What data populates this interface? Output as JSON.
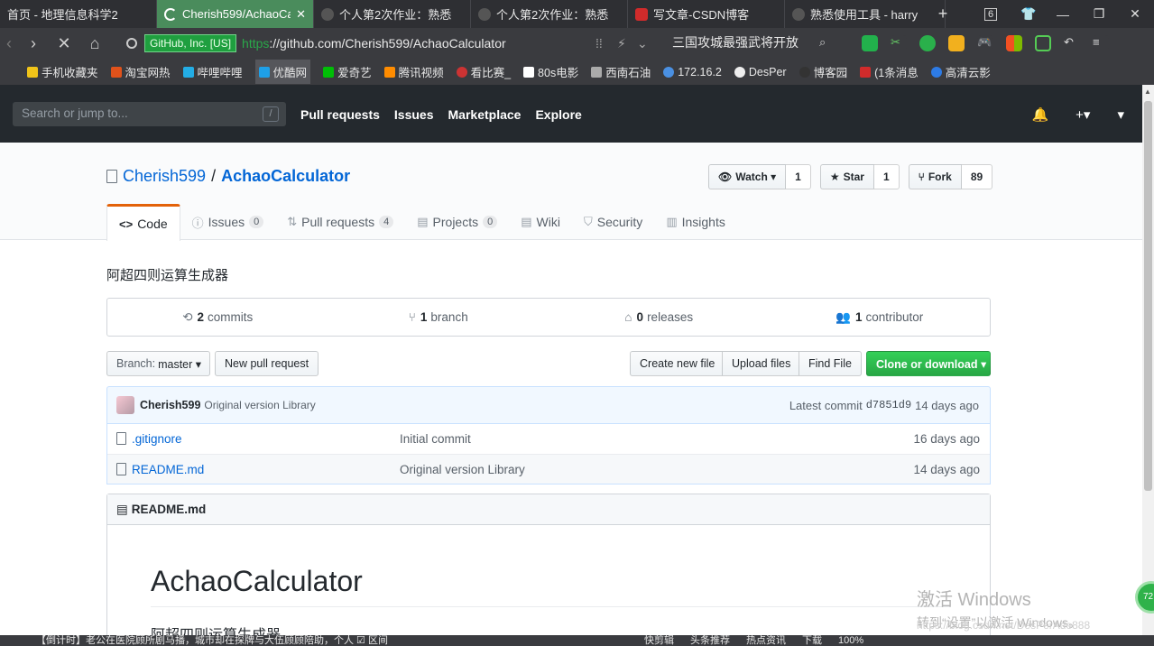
{
  "browser": {
    "tabs": [
      {
        "title": "首页 - 地理信息科学2",
        "icon_color": "#2b6cd4",
        "active": false
      },
      {
        "title": "Cherish599/AchaoCa",
        "icon_color": "#4a8c5c",
        "active": true,
        "close": "✕"
      },
      {
        "title": "个人第2次作业：熟悉",
        "icon_color": "#555",
        "active": false
      },
      {
        "title": "个人第2次作业：熟悉",
        "icon_color": "#555",
        "active": false
      },
      {
        "title": "写文章-CSDN博客",
        "icon_color": "#d12b2b",
        "active": false
      },
      {
        "title": "熟悉使用工具 - harry",
        "icon_color": "#555",
        "active": false
      }
    ],
    "new_tab": "+",
    "tab_count": "6",
    "nav": {
      "forward": "›",
      "stop": "✕",
      "home": "⌂"
    },
    "address": {
      "cert": "GitHub, Inc. [US]",
      "protocol": "https",
      "rest": "://github.com/Cherish599/AchaoCalculator"
    },
    "search_text": "三国攻城最强武将开放",
    "bookmarks": [
      {
        "label": "手机收藏夹",
        "color": "#f0c419"
      },
      {
        "label": "淘宝网热",
        "color": "#e0521b"
      },
      {
        "label": "哔哩哔哩",
        "color": "#23ade5"
      },
      {
        "label": "优酷网",
        "color": "#1ea0e8",
        "active": true
      },
      {
        "label": "爱奇艺",
        "color": "#00be06"
      },
      {
        "label": "腾讯视频",
        "color": "#ff8c00"
      },
      {
        "label": "看比赛_",
        "color": "#c33"
      },
      {
        "label": "80s电影",
        "color": "#fff"
      },
      {
        "label": "西南石油",
        "color": "#aaa"
      },
      {
        "label": "172.16.2",
        "color": "#4a90e2"
      },
      {
        "label": "DesPer",
        "color": "#eee"
      },
      {
        "label": "博客园",
        "color": "#333"
      },
      {
        "label": "(1条消息",
        "color": "#d12b2b"
      },
      {
        "label": "高清云影",
        "color": "#2d7be5"
      }
    ]
  },
  "gh_header": {
    "search_placeholder": "Search or jump to...",
    "search_key": "/",
    "nav": [
      "Pull requests",
      "Issues",
      "Marketplace",
      "Explore"
    ]
  },
  "repo": {
    "owner": "Cherish599",
    "separator": "/",
    "name": "AchaoCalculator",
    "watch": {
      "label": "Watch ▾",
      "count": "1"
    },
    "star": {
      "label": "Star",
      "count": "1"
    },
    "fork": {
      "label": "Fork",
      "count": "89"
    },
    "tabs": [
      {
        "label": "Code",
        "icon": "<>",
        "counter": null,
        "selected": true
      },
      {
        "label": "Issues",
        "icon": "ⓘ",
        "counter": "0"
      },
      {
        "label": "Pull requests",
        "icon": "⇅",
        "counter": "4"
      },
      {
        "label": "Projects",
        "icon": "▤",
        "counter": "0"
      },
      {
        "label": "Wiki",
        "icon": "▤",
        "counter": null
      },
      {
        "label": "Security",
        "icon": "⛉",
        "counter": null
      },
      {
        "label": "Insights",
        "icon": "▥",
        "counter": null
      }
    ],
    "description": "阿超四则运算生成器",
    "numbers": {
      "commits": {
        "count": "2",
        "label": "commits"
      },
      "branch": {
        "count": "1",
        "label": "branch"
      },
      "releases": {
        "count": "0",
        "label": "releases"
      },
      "contributor": {
        "count": "1",
        "label": "contributor"
      }
    },
    "branch_button": {
      "muted": "Branch:",
      "name": "master ▾"
    },
    "new_pull_request": "New pull request",
    "create_new_file": "Create new file",
    "upload_files": "Upload files",
    "find_file": "Find File",
    "clone": "Clone or download ▾",
    "latest_commit": {
      "author": "Cherish599",
      "message": "Original version Library",
      "prefix": "Latest commit",
      "sha": "d7851d9",
      "age": "14 days ago"
    },
    "files": [
      {
        "name": ".gitignore",
        "message": "Initial commit",
        "age": "16 days ago"
      },
      {
        "name": "README.md",
        "message": "Original version Library",
        "age": "14 days ago"
      }
    ],
    "readme": {
      "filename": "README.md",
      "heading": "AchaoCalculator",
      "paragraph": "阿超四则运算生成器"
    }
  },
  "overlay": {
    "watermark_line1": "激活 Windows",
    "watermark_line2": "转到“设置”以激活 Windows。",
    "blog_url": "https://blog.csdn.net/DesPerAdo888",
    "float_ball": "72"
  },
  "statusbar": {
    "left": "【倒计时】老公在医院顾所剧马播，城市却在探牌与大伍顾顾陪助，个人 ☑ 区间",
    "right": [
      "快剪辑",
      "头条推荐",
      "热点资讯",
      "下载",
      "100%"
    ]
  }
}
